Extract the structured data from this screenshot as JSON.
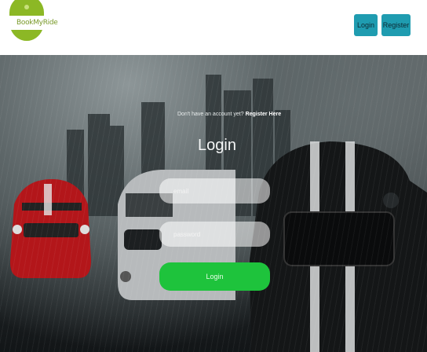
{
  "brand": {
    "logo_text": "BookMyRide",
    "logo_color": "#8cb825"
  },
  "nav": {
    "login_label": "Login",
    "register_label": "Register",
    "accent": "#1f9cb0"
  },
  "form": {
    "signup_prompt": "Don't have an account yet?",
    "signup_link": "Register Here",
    "title": "Login",
    "email_placeholder": "email",
    "password_placeholder": "password",
    "submit_label": "Login",
    "submit_color": "#1ec33c"
  }
}
